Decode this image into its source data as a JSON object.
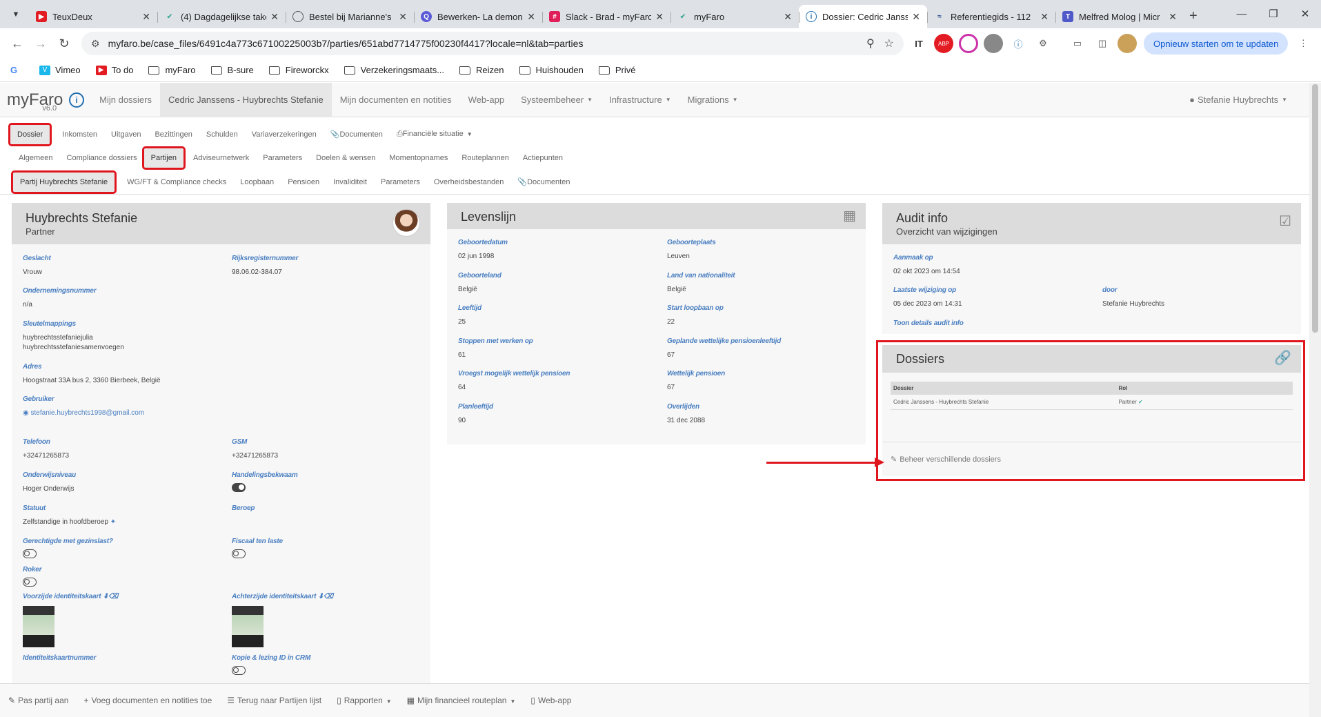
{
  "browser": {
    "tabs": [
      {
        "title": "TeuxDeux",
        "icon": "teuxdeux-icon",
        "color": "#e31b23"
      },
      {
        "title": "(4) Dagdagelijkse taken",
        "icon": "link-icon",
        "color": "#4a9"
      },
      {
        "title": "Bestel bij Marianne's",
        "icon": "globe-icon",
        "color": "#555"
      },
      {
        "title": "Bewerken- La demons",
        "icon": "q-icon",
        "color": "#5b5bd6"
      },
      {
        "title": "Slack - Brad - myFaro",
        "icon": "slack-icon",
        "color": "#e01e5a"
      },
      {
        "title": "myFaro",
        "icon": "link-icon",
        "color": "#4a9"
      },
      {
        "title": "Dossier: Cedric Janssens",
        "icon": "myfaro-icon",
        "color": "#1f6fb2"
      },
      {
        "title": "Referentiegids - 112",
        "icon": "wave-icon",
        "color": "#2b4b8c"
      },
      {
        "title": "Melfred Molog | Micr",
        "icon": "teams-icon",
        "color": "#5059c9"
      }
    ],
    "url": "myfaro.be/case_files/6491c4a773c67100225003b7/parties/651abd7714775f00230f4417?locale=nl&tab=parties",
    "update_label": "Opnieuw starten om te updaten",
    "bookmarks": [
      {
        "label": "",
        "type": "google"
      },
      {
        "label": "Vimeo",
        "type": "vimeo"
      },
      {
        "label": "To do",
        "type": "todo"
      },
      {
        "label": "myFaro",
        "type": "folder"
      },
      {
        "label": "B-sure",
        "type": "folder"
      },
      {
        "label": "Fireworckx",
        "type": "folder"
      },
      {
        "label": "Verzekeringsmaats...",
        "type": "folder"
      },
      {
        "label": "Reizen",
        "type": "folder"
      },
      {
        "label": "Huishouden",
        "type": "folder"
      },
      {
        "label": "Privé",
        "type": "folder"
      }
    ]
  },
  "app": {
    "brand": "myFaro",
    "version": "v6.0",
    "topnav": [
      "Mijn dossiers",
      "Cedric Janssens - Huybrechts Stefanie",
      "Mijn documenten en notities",
      "Web-app",
      "Systeembeheer",
      "Infrastructure",
      "Migrations"
    ],
    "user": "Stefanie Huybrechts",
    "subnav1": [
      "Dossier",
      "Inkomsten",
      "Uitgaven",
      "Bezittingen",
      "Schulden",
      "Variaverzekeringen",
      "Documenten",
      "Financiële situatie"
    ],
    "subnav2": [
      "Algemeen",
      "Compliance dossiers",
      "Partijen",
      "Adviseurnetwerk",
      "Parameters",
      "Doelen & wensen",
      "Momentopnames",
      "Routeplannen",
      "Actiepunten"
    ],
    "subnav3": [
      "Partij Huybrechts Stefanie",
      "WG/FT & Compliance checks",
      "Loopbaan",
      "Pensioen",
      "Invaliditeit",
      "Parameters",
      "Overheidsbestanden",
      "Documenten"
    ]
  },
  "party": {
    "title": "Huybrechts Stefanie",
    "subtitle": "Partner",
    "fields": {
      "geslacht_l": "Geslacht",
      "geslacht_v": "Vrouw",
      "rijks_l": "Rijksregisternummer",
      "rijks_v": "98.06.02-384.07",
      "onder_l": "Ondernemingsnummer",
      "onder_v": "n/a",
      "sleutel_l": "Sleutelmappings",
      "sleutel_v1": "huybrechtsstefaniejulia",
      "sleutel_v2": "huybrechtsstefaniesamenvoegen",
      "adres_l": "Adres",
      "adres_v": "Hoogstraat 33A bus 2, 3360 Bierbeek, België",
      "gebruiker_l": "Gebruiker",
      "gebruiker_v": "stefanie.huybrechts1998@gmail.com",
      "tel_l": "Telefoon",
      "tel_v": "+32471265873",
      "gsm_l": "GSM",
      "gsm_v": "+32471265873",
      "onderwijs_l": "Onderwijsniveau",
      "onderwijs_v": "Hoger Onderwijs",
      "handel_l": "Handelingsbekwaam",
      "statuut_l": "Statuut",
      "statuut_v": "Zelfstandige in hoofdberoep",
      "beroep_l": "Beroep",
      "gezins_l": "Gerechtigde met gezinslast?",
      "fiscaal_l": "Fiscaal ten laste",
      "roker_l": "Roker",
      "voor_l": "Voorzijde identiteitskaart",
      "achter_l": "Achterzijde identiteitskaart",
      "idnr_l": "Identiteitskaartnummer",
      "kopie_l": "Kopie & lezing ID in CRM"
    }
  },
  "levenslijn": {
    "title": "Levenslijn",
    "fields": [
      [
        "Geboortedatum",
        "02 jun 1998"
      ],
      [
        "Geboorteplaats",
        "Leuven"
      ],
      [
        "Geboorteland",
        "België"
      ],
      [
        "Land van nationaliteit",
        "België"
      ],
      [
        "Leeftijd",
        "25"
      ],
      [
        "Start loopbaan op",
        "22"
      ],
      [
        "Stoppen met werken op",
        "61"
      ],
      [
        "Geplande wettelijke pensioenleeftijd",
        "67"
      ],
      [
        "Vroegst mogelijk wettelijk pensioen",
        "64"
      ],
      [
        "Wettelijk pensioen",
        "67"
      ],
      [
        "Planleeftijd",
        "90"
      ],
      [
        "Overlijden",
        "31 dec 2088"
      ]
    ]
  },
  "audit": {
    "title": "Audit info",
    "subtitle": "Overzicht van wijzigingen",
    "aanmaak_l": "Aanmaak op",
    "aanmaak_v": "02 okt 2023 om 14:54",
    "wijz_l": "Laatste wijziging op",
    "wijz_v": "05 dec 2023 om 14:31",
    "door_l": "door",
    "door_v": "Stefanie Huybrechts",
    "toon": "Toon details audit info"
  },
  "dossiers": {
    "title": "Dossiers",
    "col_dossier": "Dossier",
    "col_rol": "Rol",
    "row_dossier": "Cedric Janssens - Huybrechts Stefanie",
    "row_rol": "Partner",
    "manage": "Beheer verschillende dossiers"
  },
  "footer": [
    "Pas partij aan",
    "Voeg documenten en notities toe",
    "Terug naar Partijen lijst",
    "Rapporten",
    "Mijn financieel routeplan",
    "Web-app"
  ]
}
